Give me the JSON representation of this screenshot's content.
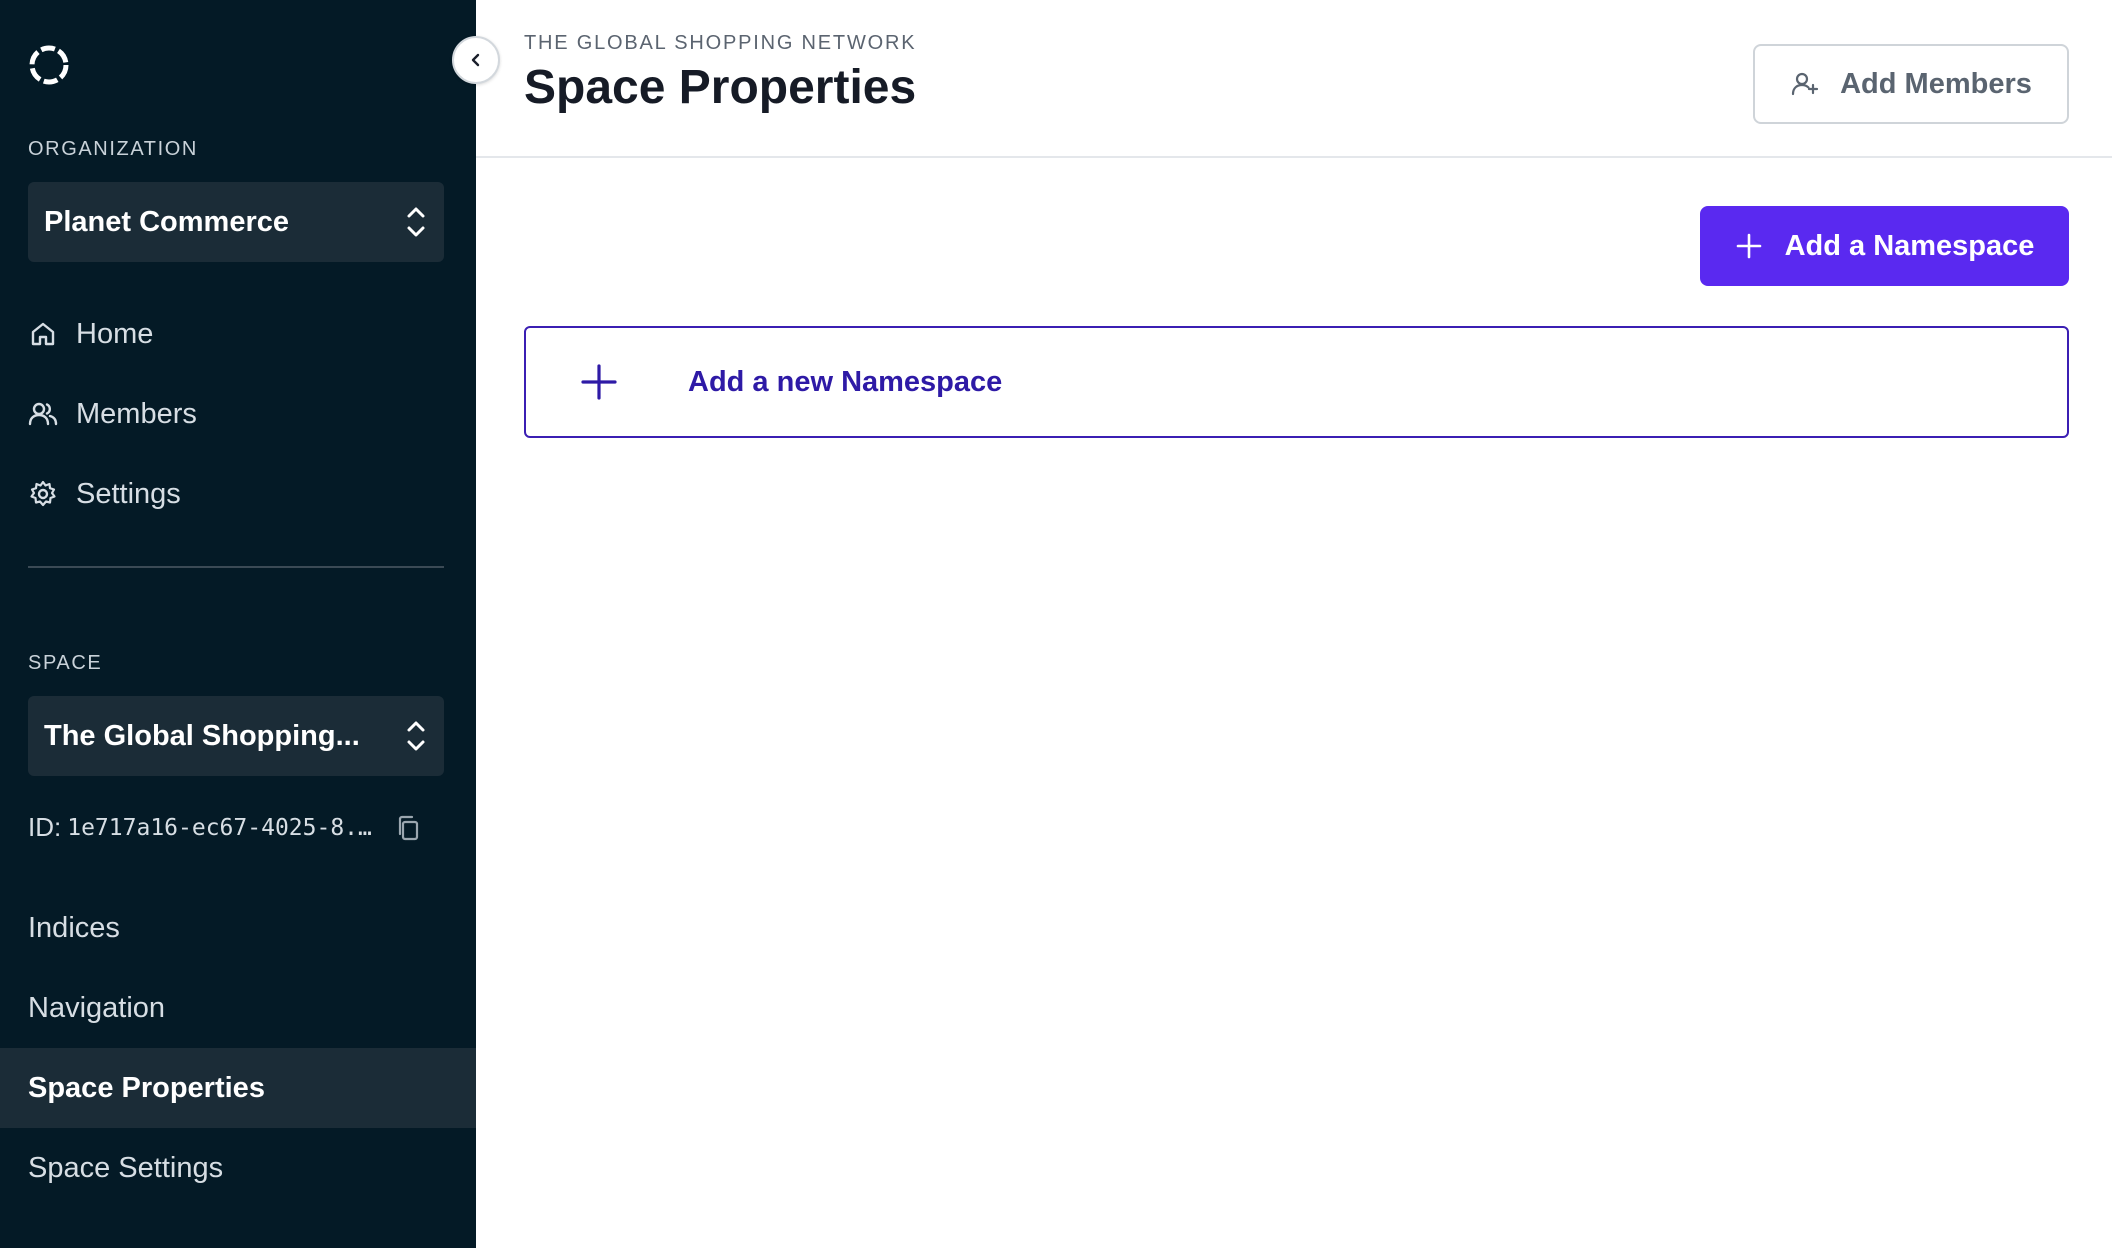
{
  "sidebar": {
    "organization_label": "ORGANIZATION",
    "organization_name": "Planet Commerce",
    "nav": [
      {
        "label": "Home",
        "icon": "home-icon"
      },
      {
        "label": "Members",
        "icon": "users-icon"
      },
      {
        "label": "Settings",
        "icon": "gear-icon"
      }
    ],
    "space_label": "SPACE",
    "space_name": "The Global Shopping...",
    "id_prefix": "ID:",
    "id_value": "1e717a16-ec67-4025-8...",
    "space_nav": [
      {
        "label": "Indices"
      },
      {
        "label": "Navigation"
      },
      {
        "label": "Space Properties"
      },
      {
        "label": "Space Settings"
      }
    ],
    "active_item": "Space Properties"
  },
  "header": {
    "breadcrumb": "THE GLOBAL SHOPPING NETWORK",
    "title": "Space Properties",
    "add_members_label": "Add Members"
  },
  "main": {
    "add_namespace_label": "Add a Namespace",
    "new_namespace_label": "Add a new Namespace"
  },
  "colors": {
    "sidebar_bg": "#041a26",
    "primary": "#5a29f0",
    "accent_dark": "#2e1aa6"
  }
}
